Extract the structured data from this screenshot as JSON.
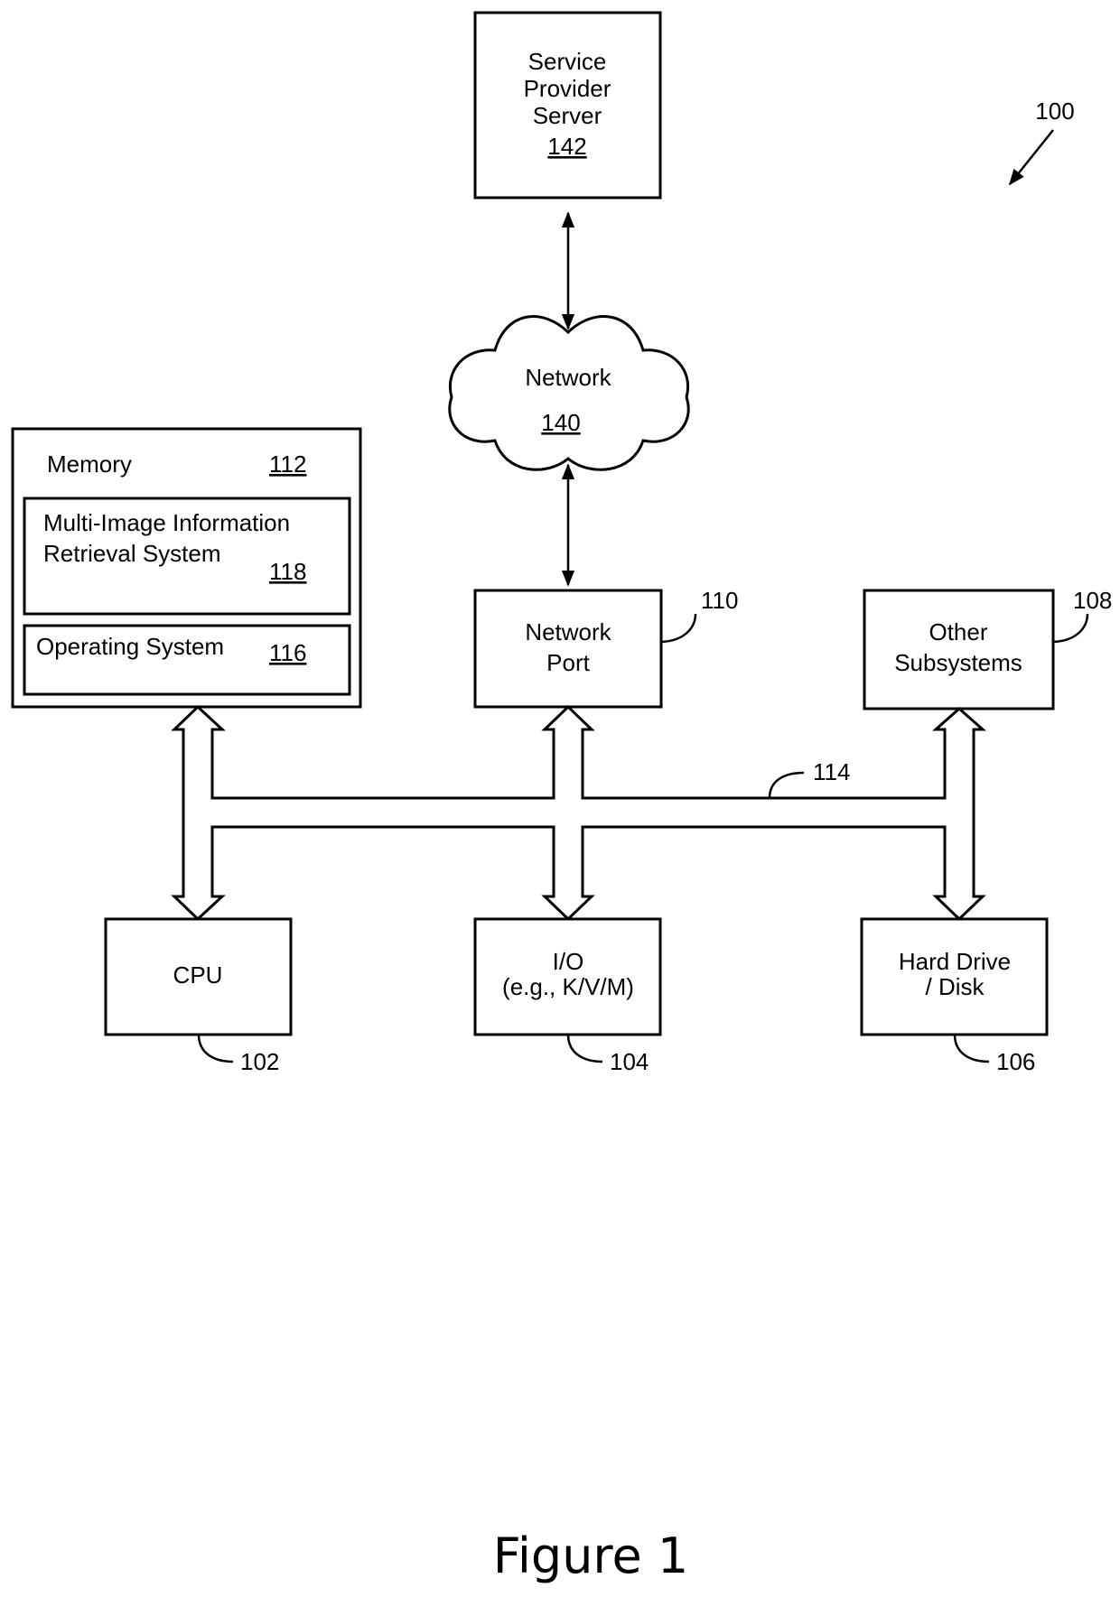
{
  "figure": {
    "reference": "100",
    "caption": "Figure 1"
  },
  "components": {
    "server": {
      "lines": [
        "Service",
        "Provider",
        "Server"
      ],
      "ref": "142"
    },
    "network": {
      "label": "Network",
      "ref": "140"
    },
    "memory": {
      "label": "Memory",
      "ref": "112"
    },
    "retrieval": {
      "lines": [
        "Multi-Image Information",
        "Retrieval System"
      ],
      "ref": "118"
    },
    "os": {
      "label": "Operating System",
      "ref": "116"
    },
    "network_port": {
      "lines": [
        "Network",
        "Port"
      ],
      "ref": "110"
    },
    "other": {
      "lines": [
        "Other",
        "Subsystems"
      ],
      "ref": "108"
    },
    "bus": {
      "ref": "114"
    },
    "cpu": {
      "label": "CPU",
      "ref": "102"
    },
    "io": {
      "lines": [
        "I/O",
        "(e.g., K/V/M)"
      ],
      "ref": "104"
    },
    "disk": {
      "lines": [
        "Hard Drive",
        "/ Disk"
      ],
      "ref": "106"
    }
  },
  "connections": [
    {
      "from": "server",
      "to": "network",
      "type": "bidirectional-arrow"
    },
    {
      "from": "network",
      "to": "network_port",
      "type": "bidirectional-arrow"
    },
    {
      "from": "memory",
      "to": "bus",
      "type": "bidirectional-block-arrow"
    },
    {
      "from": "network_port",
      "to": "bus",
      "type": "bidirectional-block-arrow"
    },
    {
      "from": "other",
      "to": "bus",
      "type": "bidirectional-block-arrow"
    },
    {
      "from": "bus",
      "to": "cpu",
      "type": "bidirectional-block-arrow"
    },
    {
      "from": "bus",
      "to": "io",
      "type": "bidirectional-block-arrow"
    },
    {
      "from": "bus",
      "to": "disk",
      "type": "bidirectional-block-arrow"
    }
  ]
}
